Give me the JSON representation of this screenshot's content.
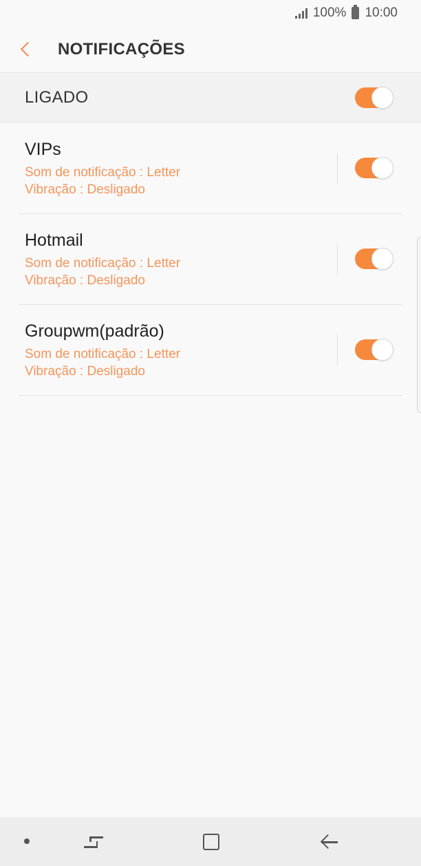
{
  "status_bar": {
    "battery_text": "100%",
    "time": "10:00"
  },
  "header": {
    "title": "NOTIFICAÇÕES"
  },
  "master": {
    "label": "LIGADO",
    "enabled": true
  },
  "accounts": [
    {
      "name": "VIPs",
      "sound": "Som de notificação : Letter",
      "vibration": "Vibração : Desligado",
      "enabled": true
    },
    {
      "name": "Hotmail",
      "sound": "Som de notificação : Letter",
      "vibration": "Vibração : Desligado",
      "enabled": true
    },
    {
      "name": "Groupwm(padrão)",
      "sound": "Som de notificação : Letter",
      "vibration": "Vibração : Desligado",
      "enabled": true
    }
  ],
  "colors": {
    "accent": "#f7893d",
    "subtext": "#f4955a"
  },
  "icons": {
    "back": "chevron-left-icon",
    "signal": "signal-icon",
    "battery": "battery-icon",
    "nav_recents": "recents-icon",
    "nav_home": "home-icon",
    "nav_back": "back-arrow-icon"
  }
}
